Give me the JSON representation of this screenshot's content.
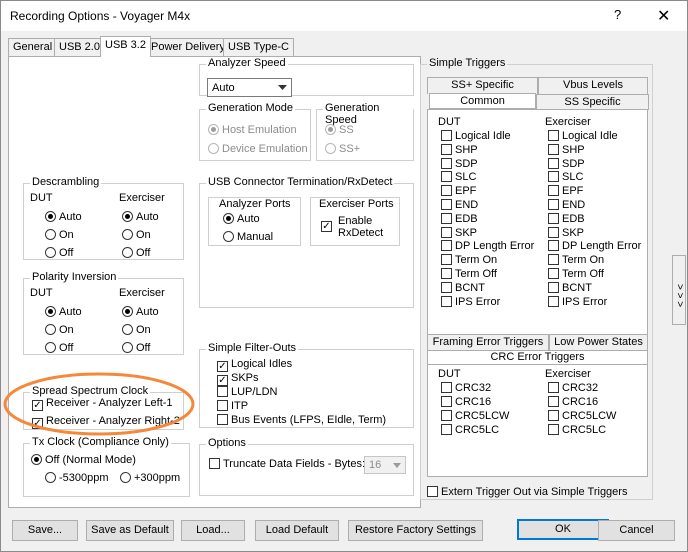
{
  "window": {
    "title": "Recording Options - Voyager M4x",
    "help": "?",
    "close": "✕"
  },
  "tabs": [
    "General",
    "USB 2.0",
    "USB 3.2",
    "Power Delivery",
    "USB Type-C"
  ],
  "analyzer_speed": {
    "label": "Analyzer Speed",
    "value": "Auto"
  },
  "generation_mode": {
    "label": "Generation Mode",
    "options": [
      "Host Emulation",
      "Device Emulation"
    ]
  },
  "generation_speed": {
    "label": "Generation Speed",
    "options": [
      "SS",
      "SS+"
    ]
  },
  "descrambling": {
    "label": "Descrambling",
    "dut": "DUT",
    "exerciser": "Exerciser",
    "options": [
      "Auto",
      "On",
      "Off"
    ]
  },
  "polarity": {
    "label": "Polarity Inversion",
    "dut": "DUT",
    "exerciser": "Exerciser",
    "options": [
      "Auto",
      "On",
      "Off"
    ]
  },
  "connector": {
    "label": "USB Connector Termination/RxDetect",
    "analyzer_ports": "Analyzer Ports",
    "auto": "Auto",
    "manual": "Manual",
    "exerciser_ports": "Exerciser Ports",
    "enable_rx": "Enable RxDetect"
  },
  "ssc": {
    "label": "Spread Spectrum Clock",
    "left": "Receiver - Analyzer Left-1",
    "right": "Receiver - Analyzer Right-2"
  },
  "tx_clock": {
    "label": "Tx Clock (Compliance Only)",
    "off": "Off (Normal Mode)",
    "minus": "-5300ppm",
    "plus": "+300ppm"
  },
  "filter_outs": {
    "label": "Simple Filter-Outs",
    "items": [
      "Logical Idles",
      "SKPs",
      "LUP/LDN",
      "ITP",
      "Bus Events (LFPS, EIdle, Term)"
    ]
  },
  "options_group": {
    "label": "Options",
    "truncate": "Truncate Data Fields - Bytes:",
    "bytes": "16"
  },
  "simple_triggers": {
    "label": "Simple Triggers",
    "tabs": [
      "SS+ Specific",
      "Vbus Levels",
      "Common",
      "SS Specific"
    ],
    "dut": "DUT",
    "exerciser": "Exerciser",
    "items": [
      "Logical Idle",
      "SHP",
      "SDP",
      "SLC",
      "EPF",
      "END",
      "EDB",
      "SKP",
      "DP Length Error",
      "Term On",
      "Term Off",
      "BCNT",
      "IPS Error"
    ],
    "tabs2": [
      "Framing Error Triggers",
      "Low Power States",
      "CRC Error Triggers"
    ],
    "crc": [
      "CRC32",
      "CRC16",
      "CRC5LCW",
      "CRC5LC"
    ],
    "extern": "Extern Trigger Out via Simple Triggers"
  },
  "side_arrows": "> > >",
  "buttons": {
    "save": "Save...",
    "save_default": "Save as Default",
    "load": "Load...",
    "load_default": "Load Default",
    "restore": "Restore Factory Settings",
    "ok": "OK",
    "cancel": "Cancel"
  },
  "colors": {
    "window_bg": "#f0f0f0",
    "pane_bg": "#ffffff",
    "annotation": "#f5883a",
    "accent": "#0078d7"
  }
}
